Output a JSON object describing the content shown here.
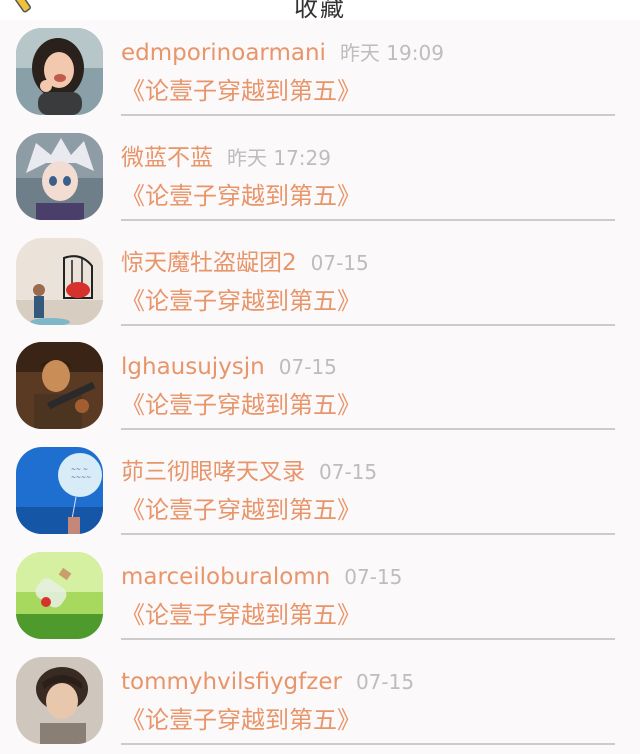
{
  "header": {
    "title": "收藏"
  },
  "items": [
    {
      "name": "edmporinoarmani",
      "time": "昨天 19:09",
      "title": "《论壹子穿越到第五》",
      "avatar_icon": "avatar-girl-laughing"
    },
    {
      "name": "微蓝不蓝",
      "time": "昨天 17:29",
      "title": "《论壹子穿越到第五》",
      "avatar_icon": "avatar-anime-boy"
    },
    {
      "name": "惊天魔牡盗龊团2",
      "time": "07-15",
      "title": "《论壹子穿越到第五》",
      "avatar_icon": "avatar-birdcage"
    },
    {
      "name": "lghausujysjn",
      "time": "07-15",
      "title": "《论壹子穿越到第五》",
      "avatar_icon": "avatar-soldier"
    },
    {
      "name": "茆三彻眼哮天叉录",
      "time": "07-15",
      "title": "《论壹子穿越到第五》",
      "avatar_icon": "avatar-balloon"
    },
    {
      "name": "marceiloburalomn",
      "time": "07-15",
      "title": "《论壹子穿越到第五》",
      "avatar_icon": "avatar-bottle-grass"
    },
    {
      "name": "tommyhvilsfiygfzer",
      "time": "07-15",
      "title": "《论壹子穿越到第五》",
      "avatar_icon": "avatar-boy-portrait"
    }
  ],
  "colors": {
    "accent": "#e8956a",
    "time": "#bdbdbd",
    "divider": "#cccccc",
    "background": "#fbf9fa"
  }
}
